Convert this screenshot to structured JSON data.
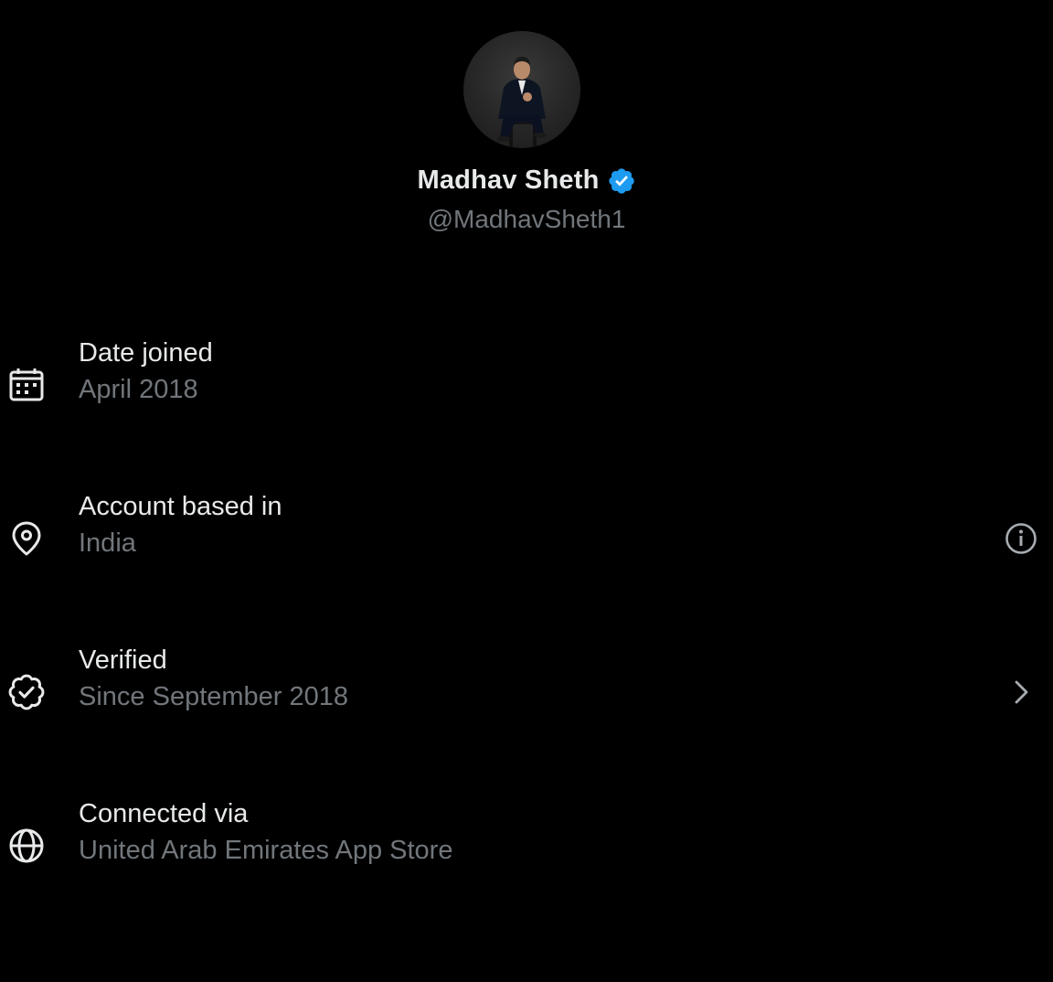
{
  "profile": {
    "name": "Madhav Sheth",
    "handle": "@MadhavSheth1",
    "avatar_icon": "profile-photo",
    "verified_icon": "verified-badge-icon"
  },
  "rows": [
    {
      "icon": "calendar-icon",
      "title": "Date joined",
      "value": "April 2018"
    },
    {
      "icon": "location-pin-icon",
      "title": "Account based in",
      "value": "India",
      "action_icon": "info-icon"
    },
    {
      "icon": "verified-outline-icon",
      "title": "Verified",
      "value": "Since September 2018",
      "action_icon": "chevron-right-icon"
    },
    {
      "icon": "globe-icon",
      "title": "Connected via",
      "value": "United Arab Emirates App Store"
    }
  ],
  "colors": {
    "background": "#000000",
    "primary_text": "#e7e9ea",
    "secondary_text": "#71767b",
    "verified_blue": "#1d9bf0"
  }
}
